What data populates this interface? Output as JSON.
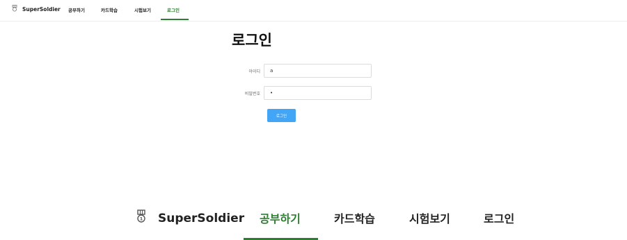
{
  "nav": {
    "brand": "SuperSoldier",
    "brand_icon": "medal-icon",
    "items": [
      "공부하기",
      "카드학습",
      "시험보기",
      "로그인"
    ],
    "active_index": 3,
    "active_color": "#2e7d32"
  },
  "login": {
    "title": "로그인",
    "id_label": "아이디",
    "id_value": "a",
    "password_label": "비밀번호",
    "password_value": "•",
    "submit_label": "로그인",
    "button_color": "#42a5f5"
  },
  "zoomed_nav": {
    "brand": "SuperSoldier",
    "items": [
      "공부하기",
      "카드학습",
      "시험보기",
      "로그인"
    ],
    "active_index": 0
  }
}
